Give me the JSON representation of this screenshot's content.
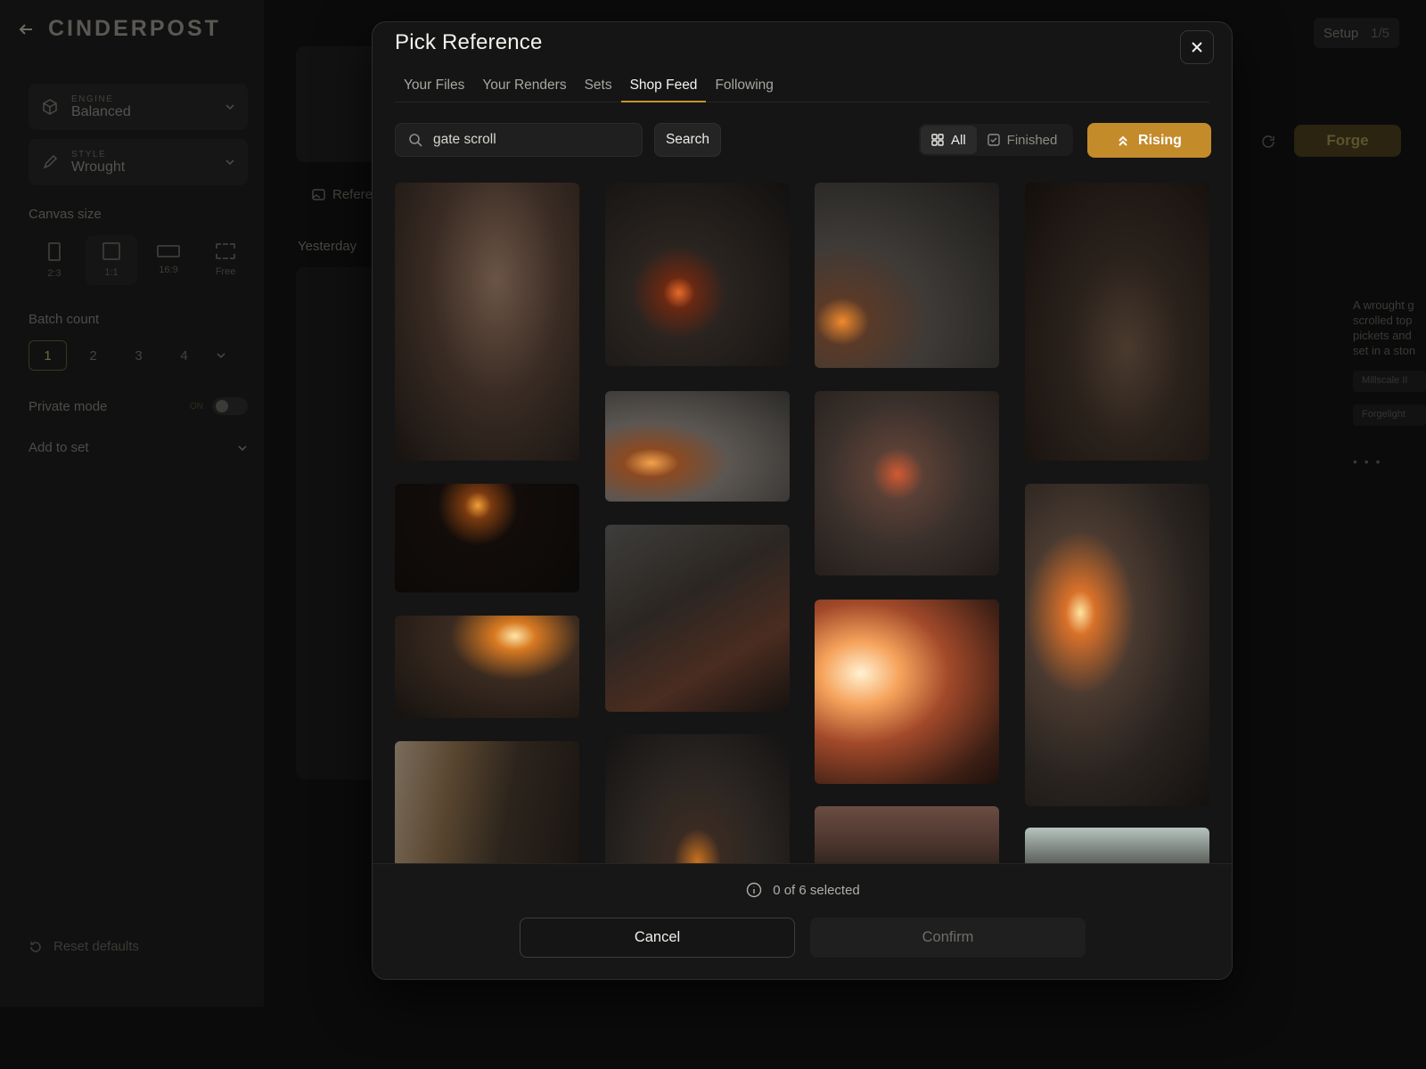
{
  "app": {
    "brand": "CINDERPOST",
    "setup_label": "Setup",
    "setup_progress": "1/5",
    "forge_label": "Forge"
  },
  "sidebar": {
    "engine_caption": "ENGINE",
    "engine_value": "Balanced",
    "style_caption": "STYLE",
    "style_value": "Wrought",
    "canvas_size_label": "Canvas size",
    "ratios": [
      "2:3",
      "1:1",
      "16:9",
      "Free"
    ],
    "batch_count_label": "Batch count",
    "batch_options": [
      "1",
      "2",
      "3",
      "4"
    ],
    "private_mode_label": "Private mode",
    "private_mode_state": "ON",
    "add_to_set_label": "Add to set",
    "reset_label": "Reset defaults"
  },
  "main": {
    "reference_label": "Refere",
    "yesterday_label": "Yesterday",
    "prompt_preview": [
      "A wrought g",
      "scrolled top",
      "pickets and",
      "set in a ston"
    ],
    "tags": [
      "Millscale II",
      "Forgelight"
    ],
    "more": "• • •"
  },
  "modal": {
    "title": "Pick Reference",
    "tabs": [
      {
        "label": "Your Files",
        "active": false
      },
      {
        "label": "Your Renders",
        "active": false
      },
      {
        "label": "Sets",
        "active": false
      },
      {
        "label": "Shop Feed",
        "active": true
      },
      {
        "label": "Following",
        "active": false
      }
    ],
    "search": {
      "value": "gate scroll",
      "placeholder": "Search",
      "button_label": "Search"
    },
    "filters": {
      "all_label": "All",
      "finished_label": "Finished",
      "active": "All"
    },
    "sort_label": "Rising",
    "accent_color": "#c48b2b",
    "selection_text": "0 of 6 selected",
    "cancel_label": "Cancel",
    "confirm_label": "Confirm"
  }
}
